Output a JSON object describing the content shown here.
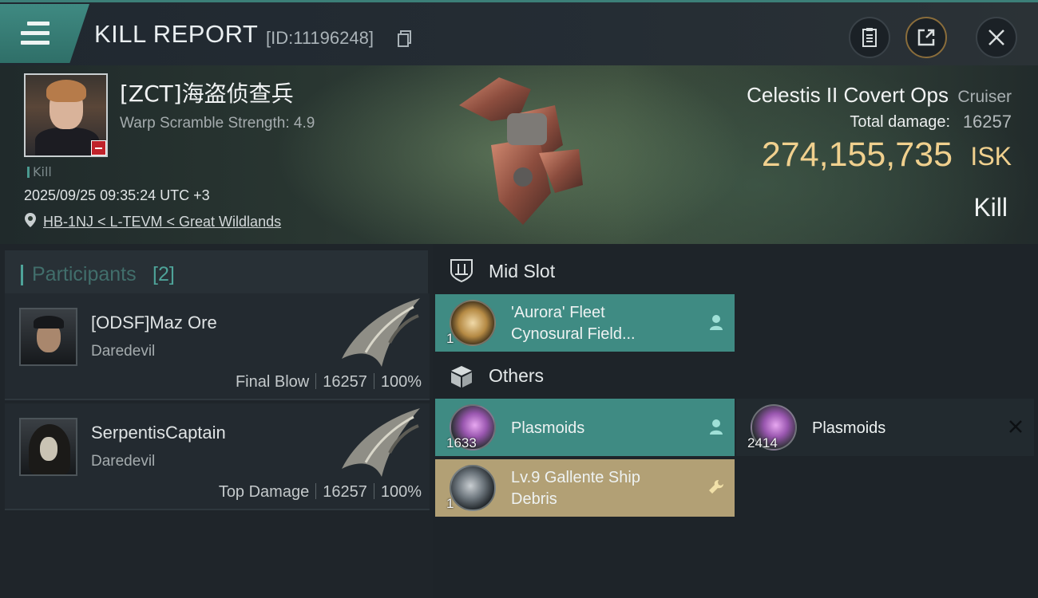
{
  "header": {
    "title": "KILL REPORT",
    "report_id": "[ID:11196248]"
  },
  "victim": {
    "name": "[ZCT]海盗侦查兵",
    "warp_scramble": "Warp Scramble Strength: 4.9",
    "tag": "Kill",
    "datetime": "2025/09/25 09:35:24 UTC +3",
    "location": "HB-1NJ < L-TEVM < Great Wildlands",
    "ship_name": "Celestis II Covert Ops",
    "ship_class": "Cruiser",
    "damage_label": "Total damage:",
    "damage_value": "16257",
    "isk_value": "274,155,735",
    "isk_unit": "ISK",
    "result": "Kill"
  },
  "participants": {
    "title": "Participants",
    "count": "[2]",
    "list": [
      {
        "name": "[ODSF]Maz Ore",
        "ship": "Daredevil",
        "role": "Final Blow",
        "damage": "16257",
        "percent": "100%"
      },
      {
        "name": "SerpentisCaptain",
        "ship": "Daredevil",
        "role": "Top Damage",
        "damage": "16257",
        "percent": "100%"
      }
    ]
  },
  "fitting": {
    "mid_slot_title": "Mid Slot",
    "others_title": "Others",
    "mid_slot": [
      {
        "name_line1": "'Aurora' Fleet",
        "name_line2": "Cynosural Field...",
        "qty": "1",
        "icon": "fist-icon"
      }
    ],
    "others": [
      {
        "name": "Plasmoids",
        "qty": "1633",
        "icon": "plasmoid-canister-icon",
        "state": "dropped"
      },
      {
        "name": "Plasmoids",
        "qty": "2414",
        "icon": "plasmoid-canister-icon",
        "state": "destroyed"
      },
      {
        "name_line1": "Lv.9 Gallente Ship",
        "name_line2": "Debris",
        "qty": "1",
        "icon": "debris-icon",
        "state": "dropped"
      }
    ]
  },
  "colors": {
    "accent_teal": "#3f8b83",
    "isk_gold": "#f0d08e",
    "salvage_gold": "#b2a075",
    "destroyed_dark": "#222a2f"
  }
}
